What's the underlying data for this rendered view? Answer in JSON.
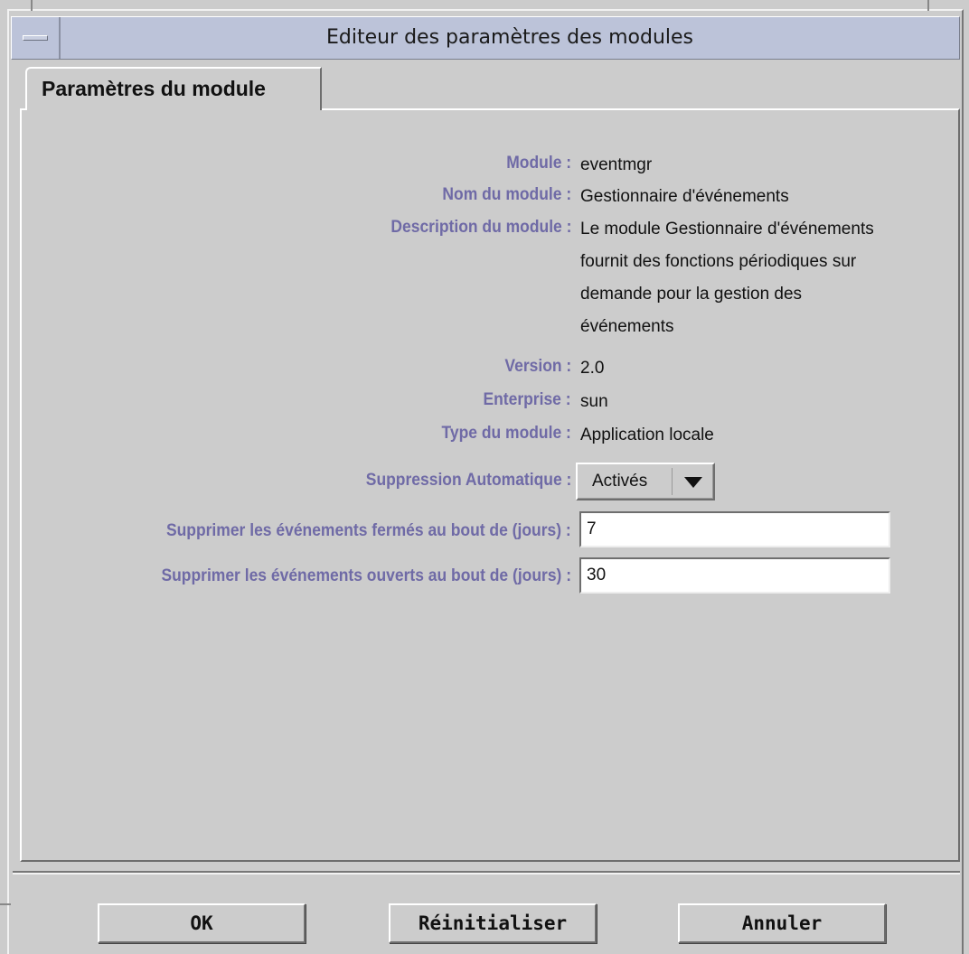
{
  "window": {
    "title": "Editeur des paramètres des modules"
  },
  "tab": {
    "label": "Paramètres du module"
  },
  "fields": {
    "module_label": "Module :",
    "module_value": "eventmgr",
    "name_label": "Nom du module :",
    "name_value": "Gestionnaire d'événements",
    "desc_label": "Description du module :",
    "desc_lines": [
      "Le module Gestionnaire d'événements",
      "fournit des fonctions périodiques sur",
      "demande pour la gestion des",
      "événements"
    ],
    "version_label": "Version :",
    "version_value": "2.0",
    "enterprise_label": "Enterprise :",
    "enterprise_value": "sun",
    "type_label": "Type du module :",
    "type_value": "Application locale",
    "auto_delete_label": "Suppression Automatique :",
    "auto_delete_value": "Activés",
    "closed_label": "Supprimer les événements fermés au bout de (jours) :",
    "closed_value": "7",
    "open_label": "Supprimer les événements ouverts au bout de (jours) :",
    "open_value": "30"
  },
  "buttons": {
    "ok": "OK",
    "reset": "Réinitialiser",
    "cancel": "Annuler"
  },
  "colors": {
    "label": "#6f6aa6",
    "titlebar": "#bcc3d9",
    "background": "#cccccc"
  },
  "icons": {
    "window_menu": "window-menu-icon",
    "dropdown": "dropdown-arrow-icon"
  }
}
